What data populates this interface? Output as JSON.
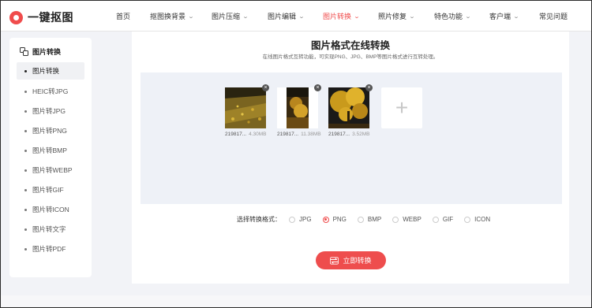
{
  "brand": {
    "name": "一键抠图"
  },
  "nav": [
    {
      "label": "首页",
      "has_menu": false,
      "active": false
    },
    {
      "label": "抠图换背景",
      "has_menu": true,
      "active": false
    },
    {
      "label": "图片压缩",
      "has_menu": true,
      "active": false
    },
    {
      "label": "图片编辑",
      "has_menu": true,
      "active": false
    },
    {
      "label": "图片转换",
      "has_menu": true,
      "active": true
    },
    {
      "label": "照片修复",
      "has_menu": true,
      "active": false
    },
    {
      "label": "特色功能",
      "has_menu": true,
      "active": false
    },
    {
      "label": "客户端",
      "has_menu": true,
      "active": false
    },
    {
      "label": "常见问题",
      "has_menu": false,
      "active": false
    }
  ],
  "sidebar": {
    "heading": "图片转换",
    "items": [
      {
        "label": "图片转换",
        "active": true
      },
      {
        "label": "HEIC转JPG",
        "active": false
      },
      {
        "label": "图片转JPG",
        "active": false
      },
      {
        "label": "图片转PNG",
        "active": false
      },
      {
        "label": "图片转BMP",
        "active": false
      },
      {
        "label": "图片转WEBP",
        "active": false
      },
      {
        "label": "图片转GIF",
        "active": false
      },
      {
        "label": "图片转ICON",
        "active": false
      },
      {
        "label": "图片转文字",
        "active": false
      },
      {
        "label": "图片转PDF",
        "active": false
      }
    ]
  },
  "main": {
    "title": "图片格式在线转换",
    "subtitle": "在线图片格式互转功能，可实现PNG、JPG、BMP等图片格式进行互转处理。",
    "files": [
      {
        "name": "219817...",
        "size": "4.30MB"
      },
      {
        "name": "219817...",
        "size": "11.38MB"
      },
      {
        "name": "219817...",
        "size": "3.52MB"
      }
    ],
    "format_label": "选择转换格式：",
    "formats": [
      {
        "label": "JPG",
        "selected": false
      },
      {
        "label": "PNG",
        "selected": true
      },
      {
        "label": "BMP",
        "selected": false
      },
      {
        "label": "WEBP",
        "selected": false
      },
      {
        "label": "GIF",
        "selected": false
      },
      {
        "label": "ICON",
        "selected": false
      }
    ],
    "convert_label": "立即转换"
  },
  "colors": {
    "accent": "#ee4d4d",
    "dropzone": "#eef1f7",
    "page_bg": "#f2f3f7"
  }
}
